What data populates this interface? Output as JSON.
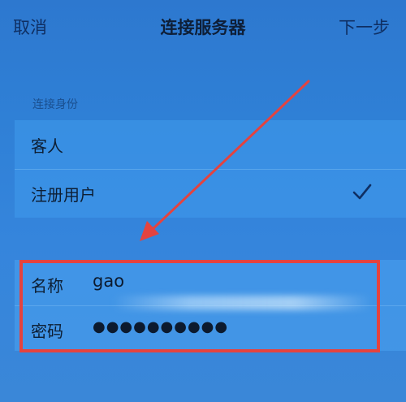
{
  "navbar": {
    "cancel_label": "取消",
    "title": "连接服务器",
    "next_label": "下一步"
  },
  "connection_identity": {
    "section_label": "连接身份",
    "options": [
      {
        "label": "客人",
        "selected": false
      },
      {
        "label": "注册用户",
        "selected": true
      }
    ]
  },
  "credentials": {
    "name_label": "名称",
    "name_value": "gao",
    "password_label": "密码",
    "password_value": "●●●●●●●●●●"
  },
  "icons": {
    "checkmark": "checkmark-icon",
    "annotation_arrow": "arrow-icon"
  },
  "colors": {
    "background": "#2f80d6",
    "annotation_red": "#e4433f",
    "accent_text": "#0f2f63"
  }
}
